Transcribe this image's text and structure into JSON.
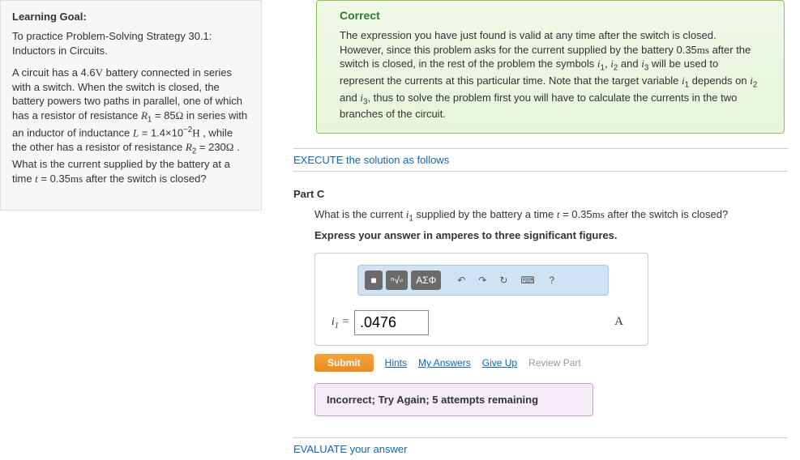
{
  "sidebar": {
    "heading": "Learning Goal:",
    "intro": "To practice Problem-Solving Strategy 30.1: Inductors in Circuits.",
    "problem_pre": "A circuit has a 4.6",
    "volt_unit": "V",
    "problem_mid1": " battery connected in series with a switch. When the switch is closed, the battery powers two paths in parallel, one of which has a resistor of resistance ",
    "r1": "R",
    "r1_sub": "1",
    "r1_eq": " = 85",
    "ohm1": "Ω",
    "mid2": " in series with an inductor of inductance ",
    "L": "L",
    "L_eq": " = 1.4×10",
    "L_sup": "−2",
    "henry": "H",
    "mid3": " , while the other has a resistor of resistance ",
    "r2": "R",
    "r2_sub": "2",
    "r2_eq": " = 230",
    "ohm2": "Ω",
    "mid4": " . What is the current supplied by the battery at a time ",
    "t": "t",
    "t_eq": " = 0.35",
    "ms": "ms",
    "end": " after the switch is closed?"
  },
  "correct": {
    "title": "Correct",
    "body_pre": "The expression you have just found is valid at any time after the switch is closed. However, since this problem asks for the current supplied by the battery 0.35",
    "ms": "ms",
    "body_mid1": " after the switch is closed, in the rest of the problem the symbols ",
    "i1": "i",
    "i1s": "1",
    "c1": ", ",
    "i2": "i",
    "i2s": "2",
    "c2": " and ",
    "i3": "i",
    "i3s": "3",
    "body_mid2": " will be used to represent the currents at this particular time. Note that the target variable ",
    "iv": "i",
    "ivs": "1",
    "body_mid3": " depends on ",
    "id2": "i",
    "id2s": "2",
    "c3": " and ",
    "id3": "i",
    "id3s": "3",
    "body_end": ", thus to solve the problem first you will have to calculate the currents in the two branches of the circuit."
  },
  "sections": {
    "execute": "EXECUTE the solution as follows",
    "evaluate": "EVALUATE your answer"
  },
  "partC": {
    "label": "Part C",
    "q_pre": "What is the current ",
    "qi": "i",
    "qis": "1",
    "q_mid": " supplied by the battery a time ",
    "qt": "t",
    "qt_eq": " = 0.35",
    "qms": "ms",
    "q_end": " after the switch is closed?",
    "instr": "Express your answer in amperes to three significant figures.",
    "var": "i",
    "var_sub": "1",
    "eq": " = ",
    "value": ".0476",
    "unit": "A"
  },
  "toolbar": {
    "t1": "■",
    "t2": "ⁿ√▫",
    "t3": "ΑΣΦ",
    "undo": "↶",
    "redo": "↷",
    "reset": "↻",
    "kbd": "⌨",
    "help": "?"
  },
  "actions": {
    "submit": "Submit",
    "hints": "Hints",
    "myanswers": "My Answers",
    "giveup": "Give Up",
    "review": "Review Part"
  },
  "feedback": "Incorrect; Try Again; 5 attempts remaining"
}
